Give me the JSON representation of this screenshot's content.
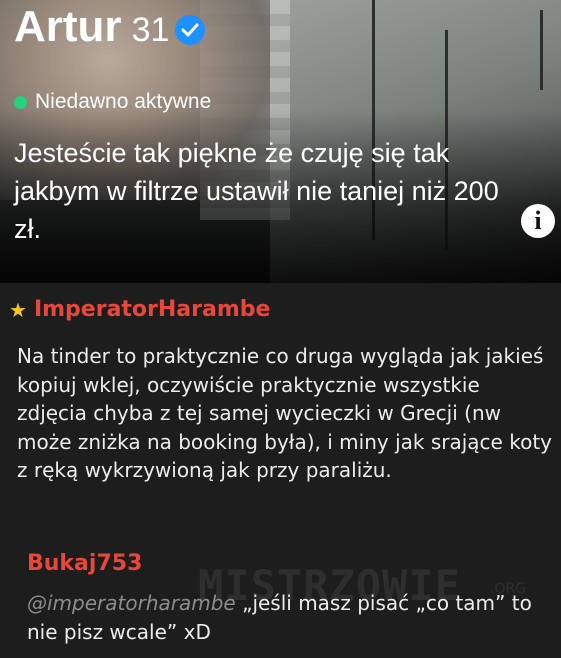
{
  "profile": {
    "name": "Artur",
    "age": "31",
    "status": "Niedawno aktywne",
    "bio": "Jesteście tak piękne że czuję się tak jakbym w filtrze ustawił nie taniej niż 200 zł.",
    "verified_icon": "verified-check-icon",
    "info_icon_label": "i",
    "colors": {
      "active_dot": "#26d07c",
      "verified": "#1e90ff"
    }
  },
  "comment": {
    "author": "ImperatorHarambe",
    "star": "★",
    "text": "Na tinder to praktycznie co druga wygląda jak jakieś kopiuj wklej, oczywiście praktycznie wszystkie zdjęcia chyba z tej samej wycieczki w Grecji (nw może zniżka na booking była), i miny jak srające koty z ręką wykrzywioną jak przy paraliżu.",
    "colors": {
      "author": "#e8483a",
      "star": "#f5c518"
    }
  },
  "reply": {
    "author": "Bukaj753",
    "mention": "@imperatorharambe",
    "text": "„jeśli masz pisać „co tam” to nie pisz wcale” xD"
  },
  "watermark": {
    "text": "MISTRZOWIE",
    "suffix": ".ORG"
  }
}
